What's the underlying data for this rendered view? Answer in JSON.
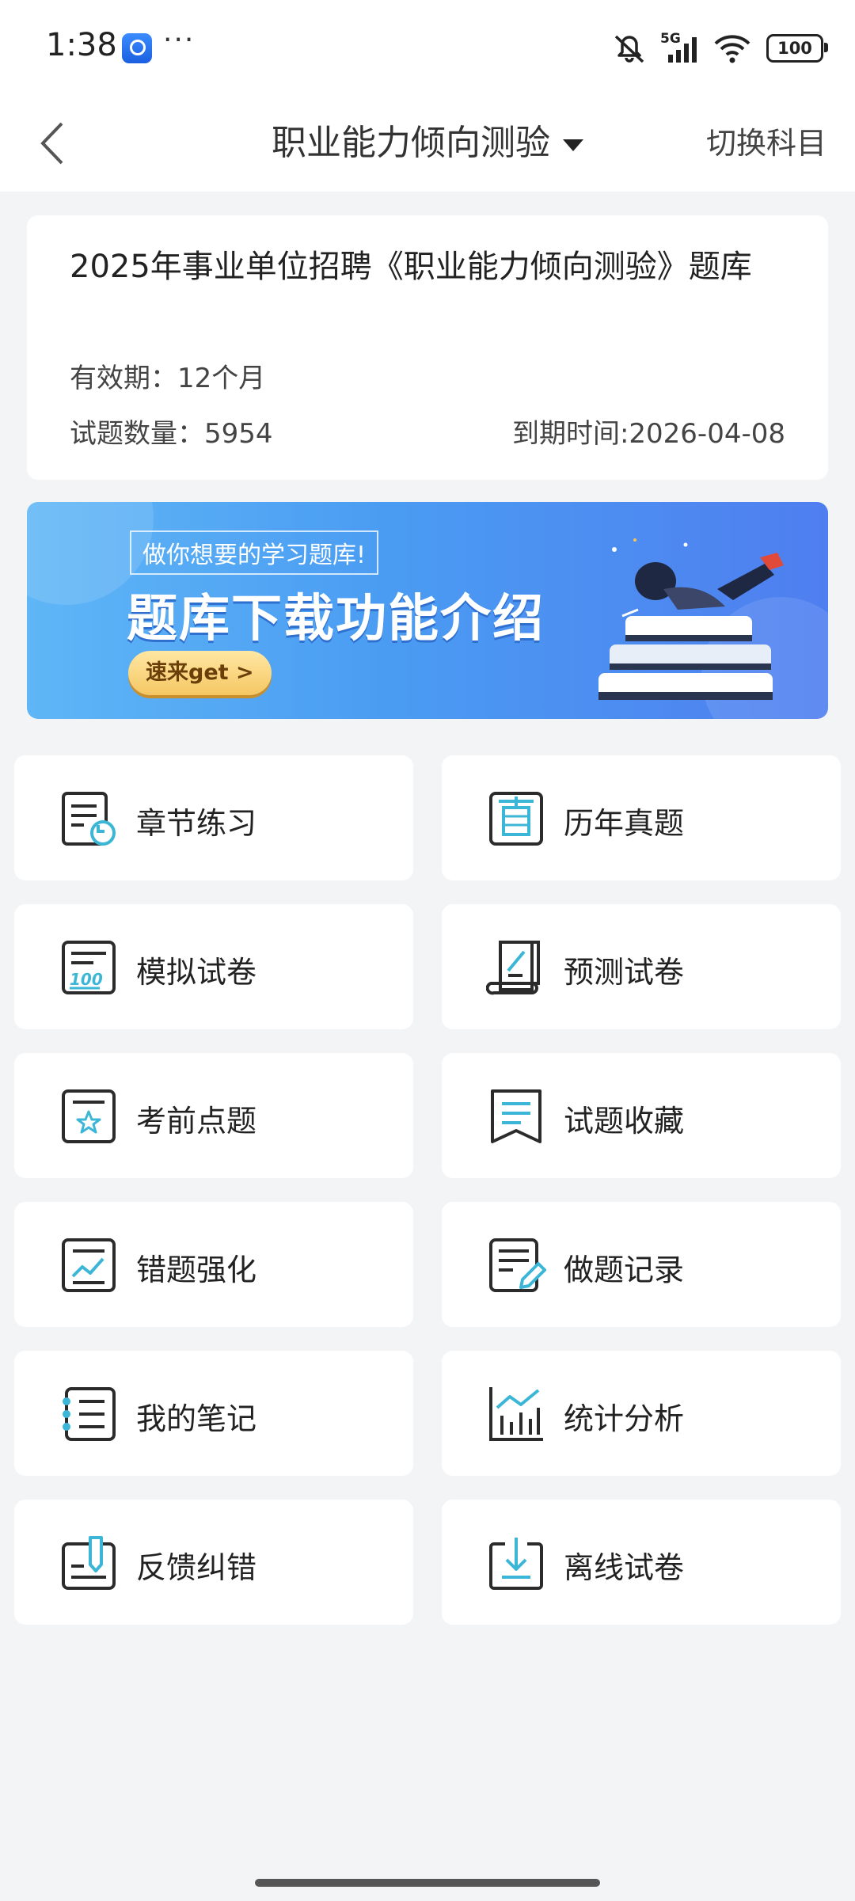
{
  "status_bar": {
    "time": "1:38",
    "more": "···",
    "network": "5G",
    "battery": "100",
    "icons": [
      "app-icon",
      "mute-icon",
      "signal-icon",
      "wifi-icon",
      "battery-icon"
    ]
  },
  "nav": {
    "title": "职业能力倾向测验",
    "switch_label": "切换科目"
  },
  "info": {
    "title": "2025年事业单位招聘《职业能力倾向测验》题库",
    "validity": "有效期：12个月",
    "count": "试题数量：5954",
    "expire": "到期时间:2026-04-08"
  },
  "banner": {
    "subtitle": "做你想要的学习题库!",
    "title": "题库下载功能介绍",
    "button": "速来get >"
  },
  "menu": [
    {
      "label": "章节练习",
      "icon": "chapter-practice-icon"
    },
    {
      "label": "历年真题",
      "icon": "past-papers-icon"
    },
    {
      "label": "模拟试卷",
      "icon": "mock-exam-icon"
    },
    {
      "label": "预测试卷",
      "icon": "forecast-exam-icon"
    },
    {
      "label": "考前点题",
      "icon": "pre-exam-tips-icon"
    },
    {
      "label": "试题收藏",
      "icon": "bookmark-icon"
    },
    {
      "label": "错题强化",
      "icon": "wrong-questions-icon"
    },
    {
      "label": "做题记录",
      "icon": "practice-record-icon"
    },
    {
      "label": "我的笔记",
      "icon": "notes-icon"
    },
    {
      "label": "统计分析",
      "icon": "statistics-icon"
    },
    {
      "label": "反馈纠错",
      "icon": "feedback-icon"
    },
    {
      "label": "离线试卷",
      "icon": "offline-download-icon"
    }
  ],
  "colors": {
    "accent": "#3cb6d6",
    "icon_stroke": "#2b2b2b",
    "background": "#f3f4f6"
  }
}
